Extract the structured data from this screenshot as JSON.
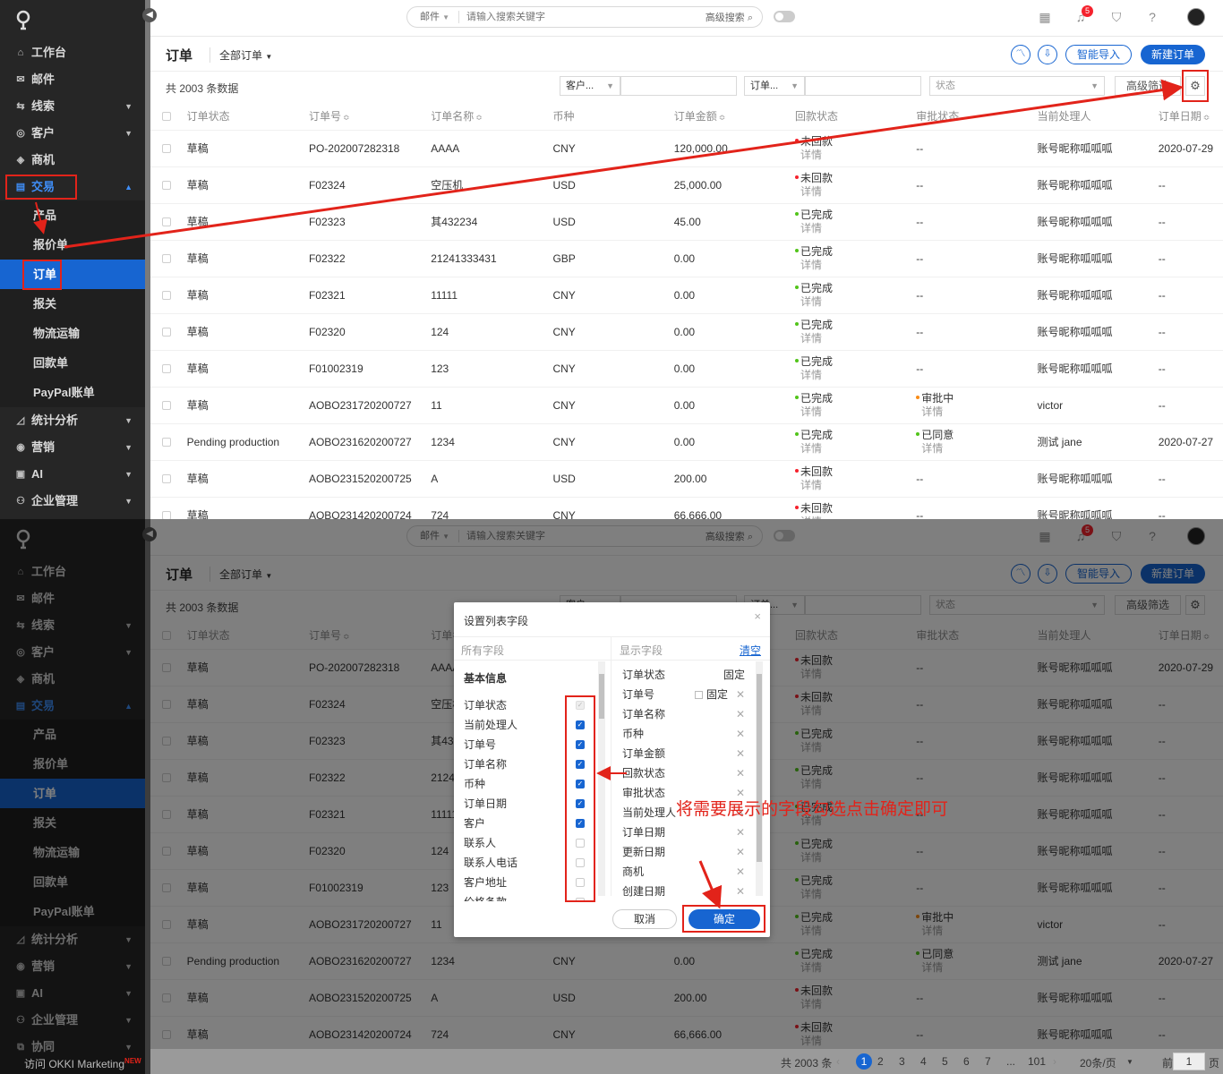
{
  "app": {
    "search": {
      "category": "邮件",
      "placeholder": "请输入搜索关键字",
      "advanced": "高级搜索"
    },
    "notification_count": "5",
    "sidebar": {
      "items": [
        {
          "label": "工作台",
          "icon": "home-icon"
        },
        {
          "label": "邮件",
          "icon": "mail-icon"
        },
        {
          "label": "线索",
          "icon": "lead-icon",
          "has_children": true
        },
        {
          "label": "客户",
          "icon": "customer-icon",
          "has_children": true
        },
        {
          "label": "商机",
          "icon": "opportunity-icon"
        },
        {
          "label": "交易",
          "icon": "trade-icon",
          "has_children": true,
          "open": true
        }
      ],
      "sub_items": [
        "产品",
        "报价单",
        "订单",
        "报关",
        "物流运输",
        "回款单",
        "PayPal账单"
      ],
      "active_sub": "订单",
      "bottom_items": [
        {
          "label": "统计分析",
          "icon": "chart-icon"
        },
        {
          "label": "营销",
          "icon": "marketing-icon"
        },
        {
          "label": "AI",
          "icon": "ai-icon"
        },
        {
          "label": "企业管理",
          "icon": "org-icon"
        },
        {
          "label": "协同",
          "icon": "collab-icon"
        }
      ],
      "visit_link": "访问 OKKI Marketing",
      "new_badge": "NEW"
    }
  },
  "page": {
    "title": "订单",
    "view": "全部订单",
    "smart_import": "智能导入",
    "new_order": "新建订单",
    "total": "共 2003 条数据",
    "filters": {
      "field1": "客户...",
      "field2": "订单...",
      "status_placeholder": "状态",
      "advanced": "高级筛选"
    },
    "columns": [
      "订单状态",
      "订单号",
      "订单名称",
      "币种",
      "订单金额",
      "回款状态",
      "审批状态",
      "当前处理人",
      "订单日期"
    ],
    "rows": [
      {
        "status": "草稿",
        "no": "PO-202007282318",
        "name": "AAAA",
        "cur": "CNY",
        "amount": "120,000.00",
        "pay": "未回款",
        "pay_color": "red",
        "detail": "详情",
        "approve": "--",
        "approve_sub": "",
        "approve_color": "",
        "owner": "账号昵称呱呱呱",
        "date": "2020-07-29"
      },
      {
        "status": "草稿",
        "no": "F02324",
        "name": "空压机",
        "cur": "USD",
        "amount": "25,000.00",
        "pay": "未回款",
        "pay_color": "red",
        "detail": "详情",
        "approve": "--",
        "approve_sub": "",
        "approve_color": "",
        "owner": "账号昵称呱呱呱",
        "date": "--"
      },
      {
        "status": "草稿",
        "no": "F02323",
        "name": "其432234",
        "cur": "USD",
        "amount": "45.00",
        "pay": "已完成",
        "pay_color": "green",
        "detail": "详情",
        "approve": "--",
        "approve_sub": "",
        "approve_color": "",
        "owner": "账号昵称呱呱呱",
        "date": "--"
      },
      {
        "status": "草稿",
        "no": "F02322",
        "name": "21241333431",
        "cur": "GBP",
        "amount": "0.00",
        "pay": "已完成",
        "pay_color": "green",
        "detail": "详情",
        "approve": "--",
        "approve_sub": "",
        "approve_color": "",
        "owner": "账号昵称呱呱呱",
        "date": "--"
      },
      {
        "status": "草稿",
        "no": "F02321",
        "name": "11111",
        "cur": "CNY",
        "amount": "0.00",
        "pay": "已完成",
        "pay_color": "green",
        "detail": "详情",
        "approve": "--",
        "approve_sub": "",
        "approve_color": "",
        "owner": "账号昵称呱呱呱",
        "date": "--"
      },
      {
        "status": "草稿",
        "no": "F02320",
        "name": "124",
        "cur": "CNY",
        "amount": "0.00",
        "pay": "已完成",
        "pay_color": "green",
        "detail": "详情",
        "approve": "--",
        "approve_sub": "",
        "approve_color": "",
        "owner": "账号昵称呱呱呱",
        "date": "--"
      },
      {
        "status": "草稿",
        "no": "F01002319",
        "name": "123",
        "cur": "CNY",
        "amount": "0.00",
        "pay": "已完成",
        "pay_color": "green",
        "detail": "详情",
        "approve": "--",
        "approve_sub": "",
        "approve_color": "",
        "owner": "账号昵称呱呱呱",
        "date": "--"
      },
      {
        "status": "草稿",
        "no": "AOBO231720200727",
        "name": "11",
        "cur": "CNY",
        "amount": "0.00",
        "pay": "已完成",
        "pay_color": "green",
        "detail": "详情",
        "approve": "审批中",
        "approve_sub": "详情",
        "approve_color": "orange",
        "owner": "victor",
        "date": "--"
      },
      {
        "status": "Pending production",
        "no": "AOBO231620200727",
        "name": "1234",
        "cur": "CNY",
        "amount": "0.00",
        "pay": "已完成",
        "pay_color": "green",
        "detail": "详情",
        "approve": "已同意",
        "approve_sub": "详情",
        "approve_color": "green",
        "owner": "测试 jane",
        "date": "2020-07-27"
      },
      {
        "status": "草稿",
        "no": "AOBO231520200725",
        "name": "A",
        "cur": "USD",
        "amount": "200.00",
        "pay": "未回款",
        "pay_color": "red",
        "detail": "详情",
        "approve": "--",
        "approve_sub": "",
        "approve_color": "",
        "owner": "账号昵称呱呱呱",
        "date": "--"
      },
      {
        "status": "草稿",
        "no": "AOBO231420200724",
        "name": "724",
        "cur": "CNY",
        "amount": "66,666.00",
        "pay": "未回款",
        "pay_color": "red",
        "detail": "详情",
        "approve": "--",
        "approve_sub": "",
        "approve_color": "",
        "owner": "账号昵称呱呱呱",
        "date": "--"
      }
    ]
  },
  "dialog": {
    "title": "设置列表字段",
    "all_fields": "所有字段",
    "shown_fields": "显示字段",
    "clear": "清空",
    "group": "基本信息",
    "fields": [
      {
        "label": "订单状态",
        "state": "disabled"
      },
      {
        "label": "当前处理人",
        "state": "on"
      },
      {
        "label": "订单号",
        "state": "on"
      },
      {
        "label": "订单名称",
        "state": "on"
      },
      {
        "label": "币种",
        "state": "on"
      },
      {
        "label": "订单日期",
        "state": "on"
      },
      {
        "label": "客户",
        "state": "on"
      },
      {
        "label": "联系人",
        "state": "off"
      },
      {
        "label": "联系人电话",
        "state": "off"
      },
      {
        "label": "客户地址",
        "state": "off"
      },
      {
        "label": "价格条款",
        "state": "off"
      }
    ],
    "shown": [
      {
        "label": "订单状态",
        "tag": "固定"
      },
      {
        "label": "订单号",
        "tag": "固定",
        "checkbox": true
      },
      {
        "label": "订单名称"
      },
      {
        "label": "币种"
      },
      {
        "label": "订单金额"
      },
      {
        "label": "回款状态"
      },
      {
        "label": "审批状态"
      },
      {
        "label": "当前处理人"
      },
      {
        "label": "订单日期"
      },
      {
        "label": "更新日期"
      },
      {
        "label": "商机"
      },
      {
        "label": "创建日期"
      }
    ],
    "cancel": "取消",
    "ok": "确定"
  },
  "annotation": "将需要展示的字段勾选点击确定即可",
  "pager": {
    "total": "共 2003 条",
    "pages": [
      "1",
      "2",
      "3",
      "4",
      "5",
      "6",
      "7",
      "...",
      "101"
    ],
    "current": "1",
    "per_page": "20条/页",
    "goto": "前往",
    "goto_value": "1",
    "page_suffix": "页"
  }
}
